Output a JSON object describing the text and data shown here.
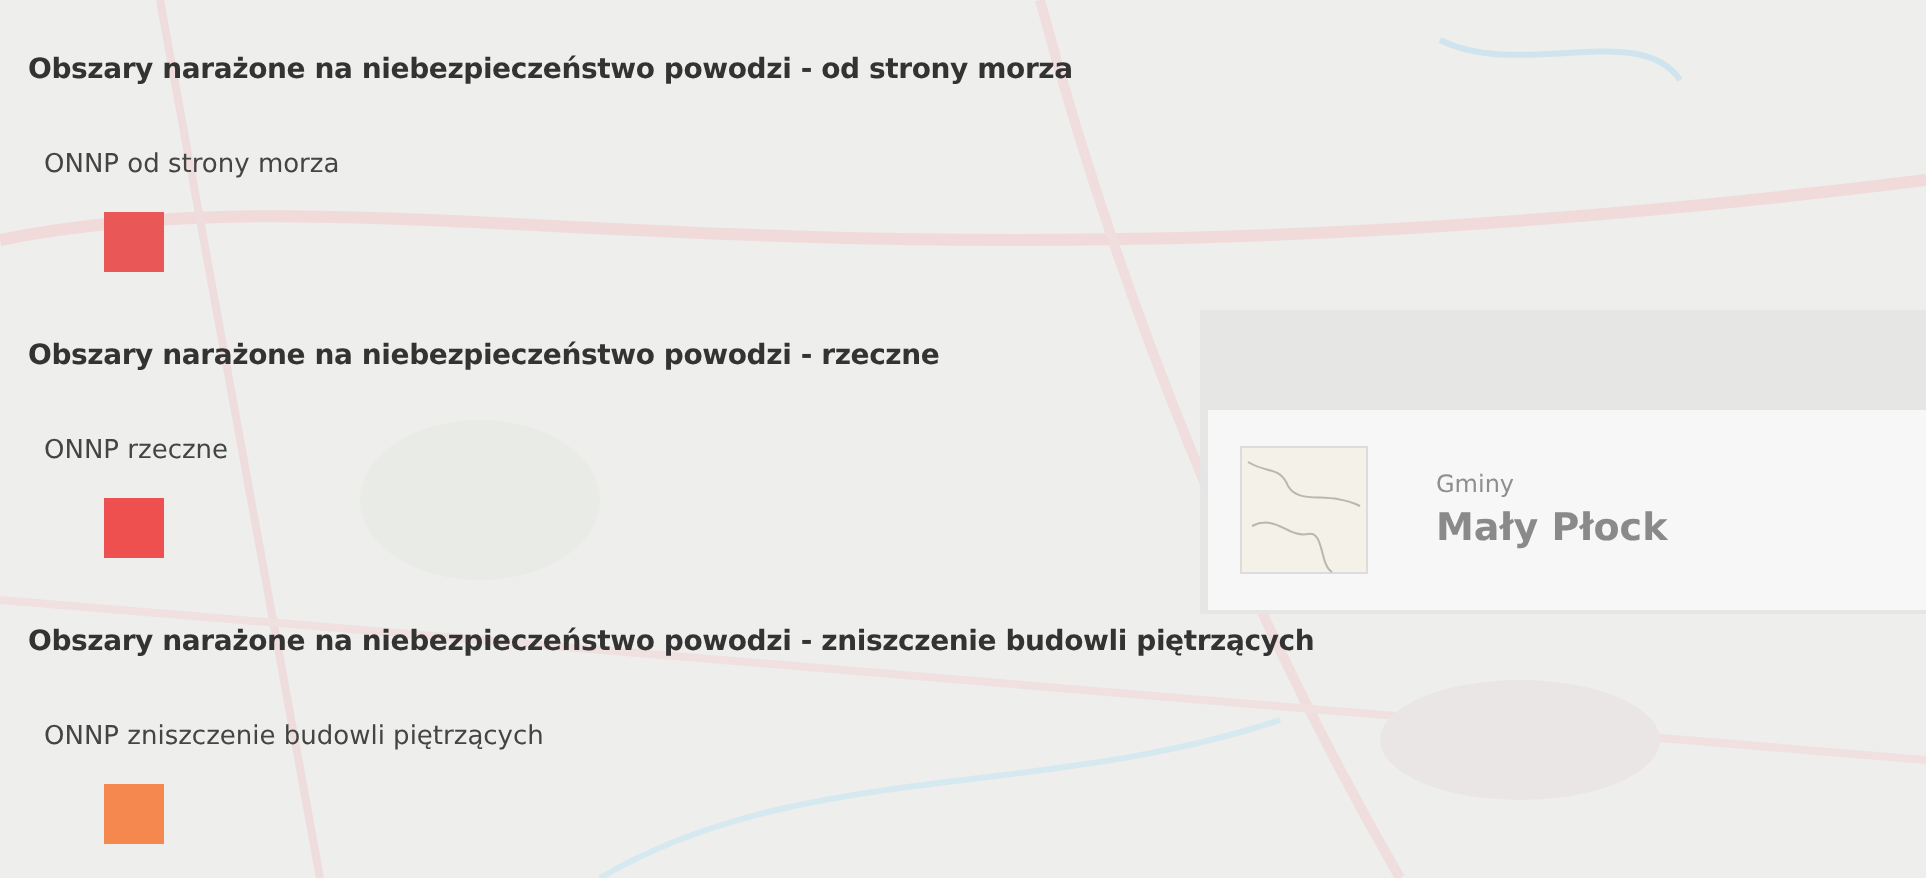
{
  "legend": {
    "groups": [
      {
        "title": "Obszary narażone na niebezpieczeństwo powodzi - od strony morza",
        "items": [
          {
            "label": "ONNP od strony morza",
            "color": "#e95757"
          }
        ]
      },
      {
        "title": "Obszary narażone na niebezpieczeństwo powodzi - rzeczne",
        "items": [
          {
            "label": "ONNP rzeczne",
            "color": "#ee5050"
          }
        ]
      },
      {
        "title": "Obszary narażone na niebezpieczeństwo powodzi - zniszczenie budowli piętrzących",
        "items": [
          {
            "label": "ONNP zniszczenie budowli piętrzących",
            "color": "#f5884f"
          }
        ]
      }
    ]
  },
  "popup": {
    "layer": "Gminy",
    "name": "Mały Płock"
  }
}
